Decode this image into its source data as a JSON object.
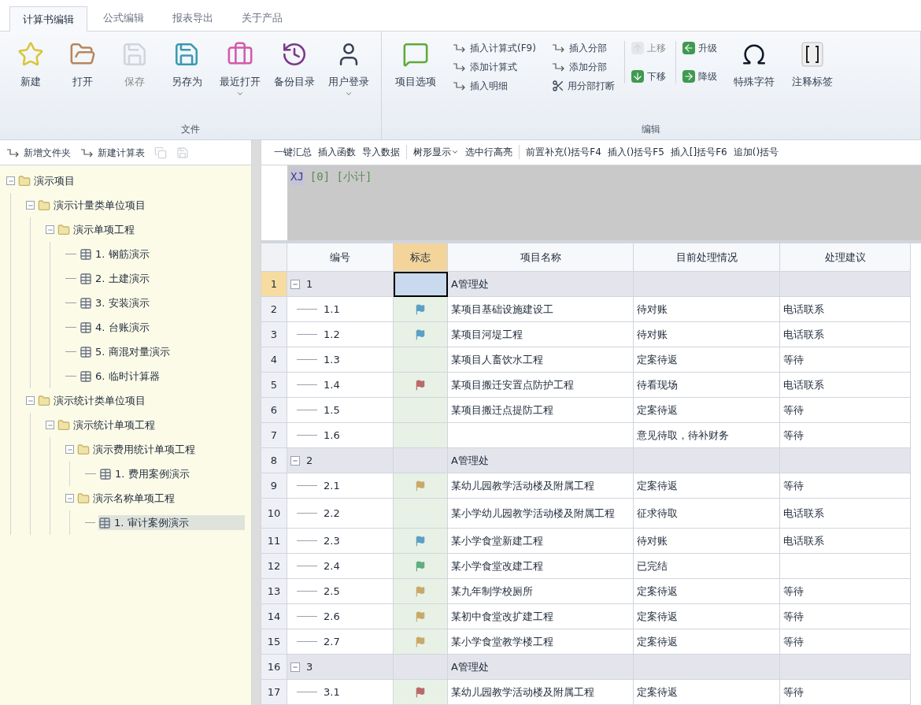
{
  "tabs": [
    {
      "label": "计算书编辑",
      "selected": true
    },
    {
      "label": "公式编辑",
      "selected": false
    },
    {
      "label": "报表导出",
      "selected": false
    },
    {
      "label": "关于产品",
      "selected": false
    }
  ],
  "ribbon": [
    {
      "title": "文件",
      "items": [
        {
          "kind": "large",
          "label": "新建",
          "disabled": false,
          "dropdown": false
        },
        {
          "kind": "large",
          "label": "打开",
          "disabled": false,
          "dropdown": false
        },
        {
          "kind": "large",
          "label": "保存",
          "disabled": true,
          "dropdown": false
        },
        {
          "kind": "large",
          "label": "另存为",
          "disabled": false,
          "dropdown": false
        },
        {
          "kind": "large",
          "label": "最近打开",
          "disabled": false,
          "dropdown": true
        },
        {
          "kind": "large",
          "label": "备份目录",
          "disabled": false,
          "dropdown": false
        },
        {
          "kind": "large",
          "label": "用户登录",
          "disabled": false,
          "dropdown": true
        }
      ]
    },
    {
      "title": "编辑",
      "items": [
        {
          "kind": "large",
          "label": "项目选项",
          "disabled": false,
          "dropdown": false
        },
        {
          "kind": "stack",
          "items": [
            {
              "label": "插入计算式(F9)",
              "disabled": false
            },
            {
              "label": "添加计算式",
              "disabled": false
            },
            {
              "label": "插入明细",
              "disabled": false
            }
          ]
        },
        {
          "kind": "stack",
          "items": [
            {
              "label": "插入分部",
              "disabled": false
            },
            {
              "label": "添加分部",
              "disabled": false
            },
            {
              "label": "用分部打断",
              "disabled": false
            }
          ]
        },
        {
          "kind": "stack",
          "items": [
            {
              "label": "上移",
              "disabled": true
            },
            {
              "label": "下移",
              "disabled": false
            }
          ]
        },
        {
          "kind": "stack",
          "items": [
            {
              "label": "升级",
              "disabled": false
            },
            {
              "label": "降级",
              "disabled": false
            }
          ]
        },
        {
          "kind": "large",
          "label": "特殊字符",
          "disabled": false,
          "dropdown": false
        },
        {
          "kind": "large",
          "label": "注释标签",
          "disabled": false,
          "dropdown": false
        }
      ]
    }
  ],
  "tree_toolbar": [
    "新增文件夹",
    "新建计算表"
  ],
  "tree": [
    {
      "label": "演示项目",
      "kind": "folder",
      "expanded": true,
      "selected": false,
      "children": [
        {
          "label": "演示计量类单位项目",
          "kind": "folder",
          "expanded": true,
          "selected": false,
          "children": [
            {
              "label": "演示单项工程",
              "kind": "folder",
              "expanded": true,
              "selected": false,
              "children": [
                {
                  "label": "1. 钢筋演示",
                  "kind": "sheet",
                  "selected": false
                },
                {
                  "label": "2. 土建演示",
                  "kind": "sheet",
                  "selected": false
                },
                {
                  "label": "3. 安装演示",
                  "kind": "sheet",
                  "selected": false
                },
                {
                  "label": "4. 台账演示",
                  "kind": "sheet",
                  "selected": false
                },
                {
                  "label": "5. 商混对量演示",
                  "kind": "sheet",
                  "selected": false
                },
                {
                  "label": "6. 临时计算器",
                  "kind": "sheet",
                  "selected": false
                }
              ]
            }
          ]
        },
        {
          "label": "演示统计类单位项目",
          "kind": "folder",
          "expanded": true,
          "selected": false,
          "children": [
            {
              "label": "演示统计单项工程",
              "kind": "folder",
              "expanded": true,
              "selected": false,
              "children": [
                {
                  "label": "演示费用统计单项工程",
                  "kind": "folder",
                  "expanded": true,
                  "selected": false,
                  "children": [
                    {
                      "label": "1. 费用案例演示",
                      "kind": "sheet",
                      "selected": false
                    }
                  ]
                },
                {
                  "label": "演示名称单项工程",
                  "kind": "folder",
                  "expanded": true,
                  "selected": false,
                  "children": [
                    {
                      "label": "1. 审计案例演示",
                      "kind": "sheet",
                      "selected": true
                    }
                  ]
                }
              ]
            }
          ]
        }
      ]
    }
  ],
  "grid_toolbar": [
    [
      {
        "label": "一键汇总",
        "dropdown": false
      },
      {
        "label": "插入函数",
        "dropdown": false
      },
      {
        "label": "导入数据",
        "dropdown": false
      }
    ],
    [
      {
        "label": "树形显示",
        "dropdown": true
      },
      {
        "label": "选中行高亮",
        "dropdown": false
      }
    ],
    [
      {
        "label": "前置补充()括号F4",
        "dropdown": false
      },
      {
        "label": "插入()括号F5",
        "dropdown": false
      },
      {
        "label": "插入[]括号F6",
        "dropdown": false
      },
      {
        "label": "追加()括号",
        "dropdown": false
      }
    ]
  ],
  "formula": {
    "variable": "XJ",
    "rest": "[0] [小计]"
  },
  "table": {
    "columns": [
      "编号",
      "标志",
      "项目名称",
      "目前处理情况",
      "处理建议"
    ],
    "rows": [
      {
        "kind": "group",
        "num": "1",
        "code": "1",
        "expanded": true,
        "selected": true,
        "name": "A管理处"
      },
      {
        "kind": "item",
        "num": "2",
        "code": "1.1",
        "selected": false,
        "color": "#5b9fc4",
        "name": "某项目基础设施建设工",
        "status": "待对账",
        "advice": "电话联系"
      },
      {
        "kind": "item",
        "num": "3",
        "code": "1.2",
        "selected": false,
        "color": "#5b9fc4",
        "name": "某项目河堤工程",
        "status": "待对账",
        "advice": "电话联系"
      },
      {
        "kind": "item",
        "num": "4",
        "code": "1.3",
        "selected": false,
        "name": "某项目人畜饮水工程",
        "status": "定案待返",
        "advice": "等待"
      },
      {
        "kind": "item",
        "num": "5",
        "code": "1.4",
        "selected": false,
        "color": "#b86a6a",
        "name": "某项目搬迁安置点防护工程",
        "status": "待看现场",
        "advice": "电话联系"
      },
      {
        "kind": "item",
        "num": "6",
        "code": "1.5",
        "selected": false,
        "name": "某项目搬迁点提防工程",
        "status": "定案待返",
        "advice": "等待"
      },
      {
        "kind": "item",
        "num": "7",
        "code": "1.6",
        "selected": false,
        "status": "意见待取，待补财务",
        "advice": "等待"
      },
      {
        "kind": "group",
        "num": "8",
        "code": "2",
        "expanded": true,
        "selected": false,
        "name": "A管理处"
      },
      {
        "kind": "item",
        "num": "9",
        "code": "2.1",
        "selected": false,
        "color": "#c9a96a",
        "name": "某幼儿园教学活动楼及附属工程",
        "status": "定案待返",
        "advice": "等待"
      },
      {
        "kind": "item",
        "num": "10",
        "code": "2.2",
        "selected": false,
        "name": "某小学幼儿园教学活动楼及附属工程",
        "status": "征求待取",
        "advice": "电话联系"
      },
      {
        "kind": "item",
        "num": "11",
        "code": "2.3",
        "selected": false,
        "color": "#5b9fc4",
        "name": "某小学食堂新建工程",
        "status": "待对账",
        "advice": "电话联系"
      },
      {
        "kind": "item",
        "num": "12",
        "code": "2.4",
        "selected": false,
        "color": "#5fae7e",
        "name": "某小学食堂改建工程",
        "status": "已完结"
      },
      {
        "kind": "item",
        "num": "13",
        "code": "2.5",
        "selected": false,
        "color": "#c9a96a",
        "name": "某九年制学校厕所",
        "status": "定案待返",
        "advice": "等待"
      },
      {
        "kind": "item",
        "num": "14",
        "code": "2.6",
        "selected": false,
        "color": "#c9a96a",
        "name": "某初中食堂改扩建工程",
        "status": "定案待返",
        "advice": "等待"
      },
      {
        "kind": "item",
        "num": "15",
        "code": "2.7",
        "selected": false,
        "color": "#c9a96a",
        "name": "某小学食堂教学楼工程",
        "status": "定案待返",
        "advice": "等待"
      },
      {
        "kind": "group",
        "num": "16",
        "code": "3",
        "expanded": true,
        "selected": false,
        "name": "A管理处"
      },
      {
        "kind": "item",
        "num": "17",
        "code": "3.1",
        "selected": false,
        "color": "#b86a6a",
        "name": "某幼儿园教学活动楼及附属工程",
        "status": "定案待返",
        "advice": "等待"
      }
    ]
  }
}
